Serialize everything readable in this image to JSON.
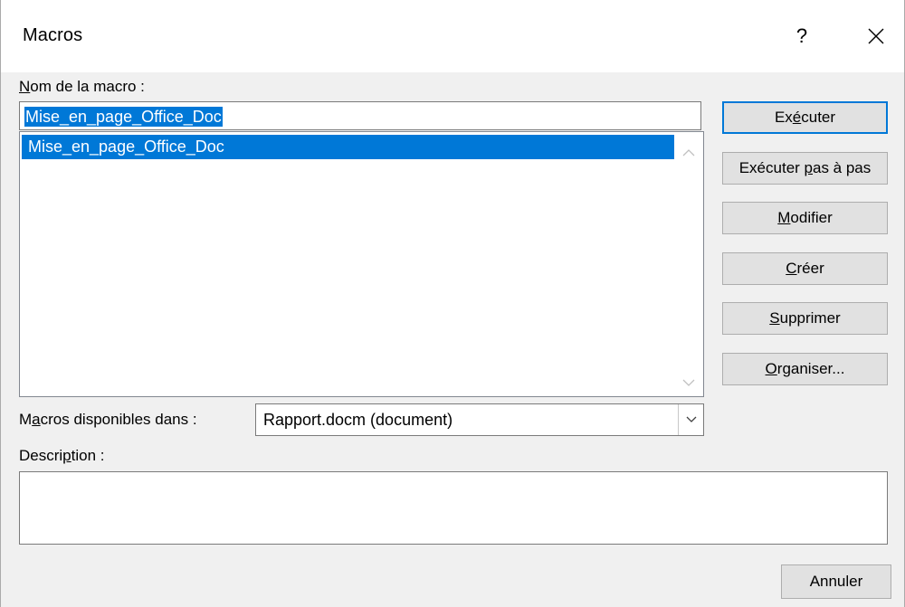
{
  "window": {
    "title": "Macros",
    "help_glyph": "?"
  },
  "macro_name": {
    "label_access": "N",
    "label_rest": "om de la macro :",
    "value": "Mise_en_page_Office_Doc"
  },
  "macro_list": {
    "items": [
      "Mise_en_page_Office_Doc"
    ],
    "selected_index": 0
  },
  "buttons": {
    "run": {
      "pre": "Ex",
      "key": "é",
      "post": "cuter"
    },
    "step_into": {
      "pre": "Exécuter ",
      "key": "p",
      "post": "as à pas"
    },
    "edit": {
      "pre": "",
      "key": "M",
      "post": "odifier"
    },
    "create": {
      "pre": "",
      "key": "C",
      "post": "réer"
    },
    "delete": {
      "pre": "",
      "key": "S",
      "post": "upprimer"
    },
    "organizer": {
      "pre": "",
      "key": "O",
      "post": "rganiser..."
    },
    "cancel": {
      "label": "Annuler"
    }
  },
  "macros_in": {
    "label_pre": "M",
    "label_key": "a",
    "label_post": "cros disponibles dans :",
    "selected": "Rapport.docm (document)"
  },
  "description": {
    "label_pre": "Descri",
    "label_key": "p",
    "label_post": "tion :",
    "value": ""
  },
  "icons": {
    "close": "close-icon",
    "help": "help-icon",
    "scroll_up": "chevron-up-icon",
    "scroll_down": "chevron-down-icon",
    "dropdown": "chevron-down-icon"
  },
  "colors": {
    "selection": "#0078d7",
    "dialog_bg": "#f0f0f0",
    "button_bg": "#e1e1e1"
  }
}
